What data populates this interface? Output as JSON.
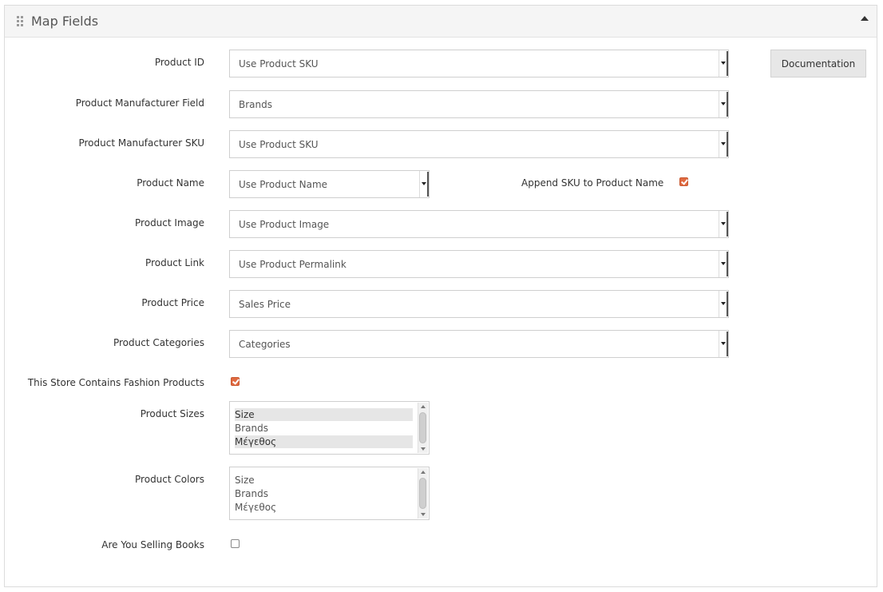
{
  "panel": {
    "title": "Map Fields"
  },
  "documentation_label": "Documentation",
  "fields": {
    "product_id": {
      "label": "Product ID",
      "value": "Use Product SKU"
    },
    "manufacturer_field": {
      "label": "Product Manufacturer Field",
      "value": "Brands"
    },
    "manufacturer_sku": {
      "label": "Product Manufacturer SKU",
      "value": "Use Product SKU"
    },
    "product_name": {
      "label": "Product Name",
      "value": "Use Product Name"
    },
    "append_sku": {
      "label": "Append SKU to Product Name",
      "checked": true
    },
    "product_image": {
      "label": "Product Image",
      "value": "Use Product Image"
    },
    "product_link": {
      "label": "Product Link",
      "value": "Use Product Permalink"
    },
    "product_price": {
      "label": "Product Price",
      "value": "Sales Price"
    },
    "product_categories": {
      "label": "Product Categories",
      "value": "Categories"
    },
    "fashion": {
      "label": "This Store Contains Fashion Products",
      "checked": true
    },
    "product_sizes": {
      "label": "Product Sizes",
      "options": [
        "Size",
        "Brands",
        "Μέγεθος"
      ],
      "selected": [
        true,
        false,
        true
      ]
    },
    "product_colors": {
      "label": "Product Colors",
      "options": [
        "Size",
        "Brands",
        "Μέγεθος"
      ],
      "selected": [
        false,
        false,
        false
      ]
    },
    "books": {
      "label": "Are You Selling Books",
      "checked": false
    }
  },
  "colors": {
    "checkbox_on": "#e06a41"
  }
}
